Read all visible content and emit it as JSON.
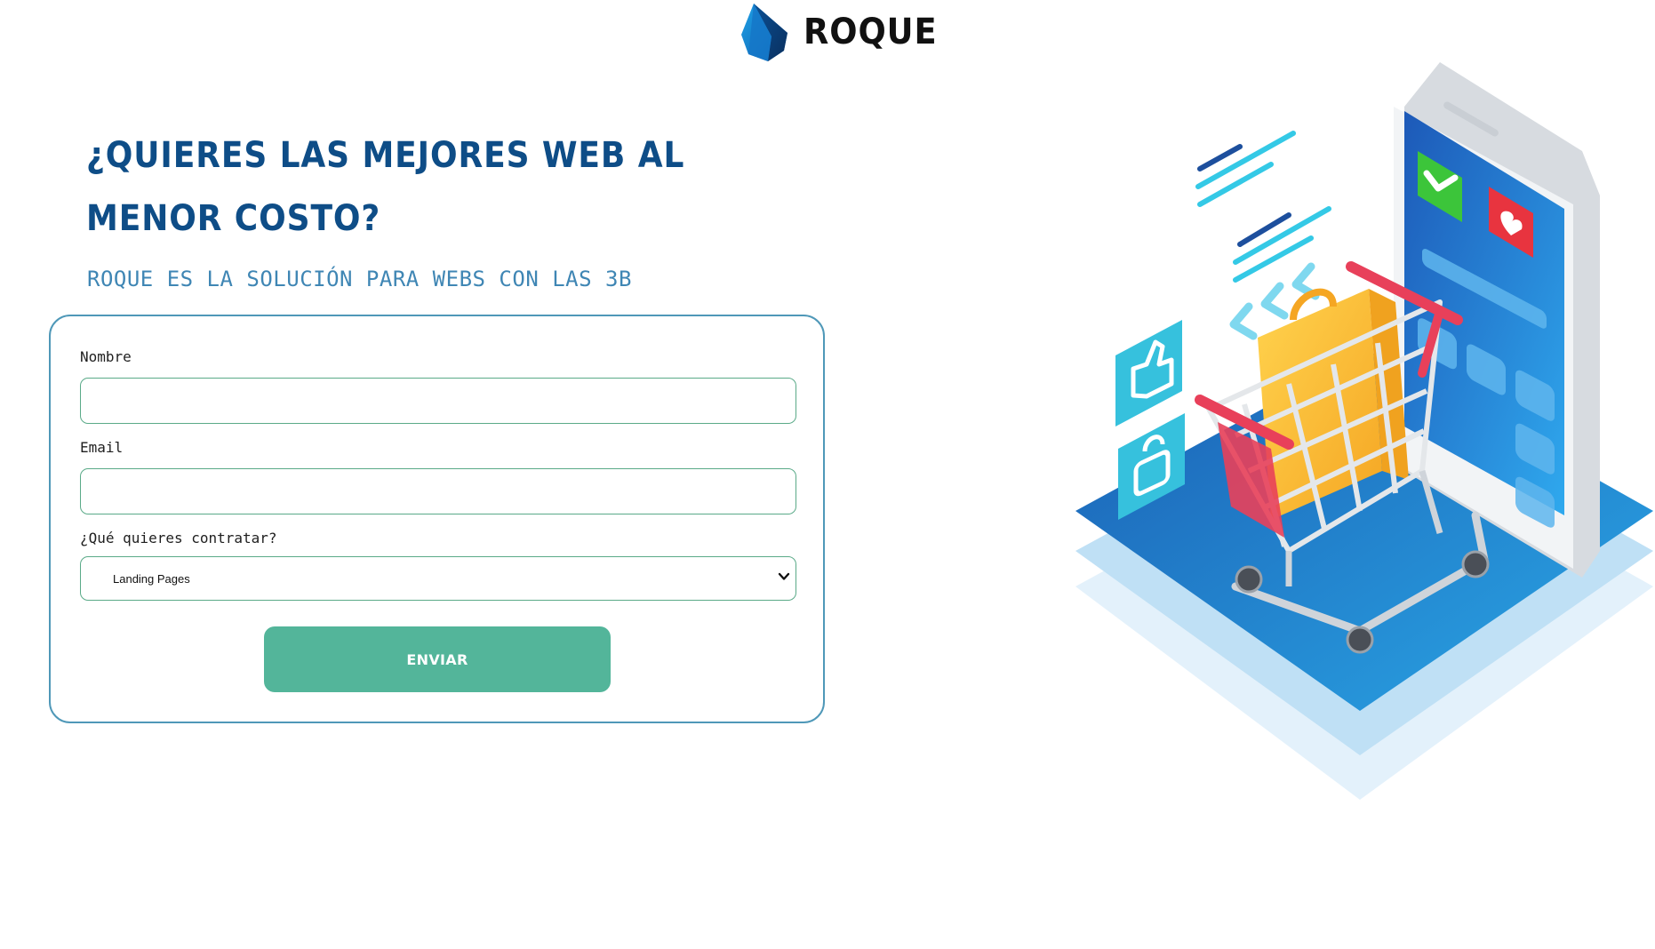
{
  "brand": {
    "name": "ROQUE",
    "logo_icon": "blue-gem-icon"
  },
  "hero": {
    "title": "¿QUIERES LAS MEJORES WEB AL MENOR COSTO?",
    "subtitle": "ROQUE ES LA SOLUCIÓN PARA WEBS CON LAS 3B"
  },
  "form": {
    "name_label": "Nombre",
    "name_value": "",
    "email_label": "Email",
    "email_value": "",
    "service_label": "¿Qué quieres contratar?",
    "service_selected": "Landing Pages",
    "submit_label": "ENVIAR"
  },
  "illustration": {
    "icon": "shopping-cart-phone-illustration"
  },
  "colors": {
    "title": "#0e4d87",
    "subtitle": "#3f86b4",
    "card_border": "#4f98b8",
    "input_border": "#5aaa88",
    "button": "#53b59a",
    "button_text": "#ffffff"
  }
}
